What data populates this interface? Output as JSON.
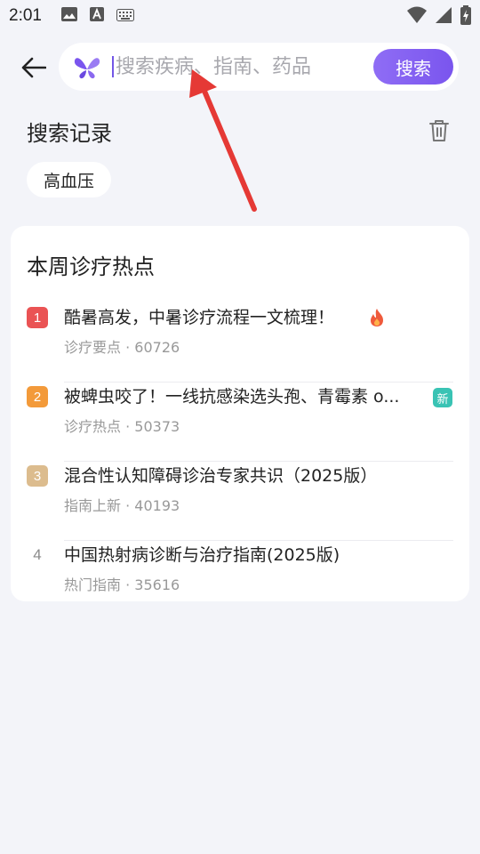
{
  "status_bar": {
    "time": "2:01"
  },
  "search": {
    "placeholder": "搜索疾病、指南、药品",
    "value": "",
    "button_label": "搜索"
  },
  "history": {
    "title": "搜索记录",
    "items": [
      "高血压"
    ]
  },
  "hot": {
    "title": "本周诊疗热点",
    "items": [
      {
        "rank": "1",
        "title": "酷暑高发，中暑诊疗流程一文梳理！",
        "category": "诊疗要点",
        "count": "60726",
        "badge": "fire-icon"
      },
      {
        "rank": "2",
        "title": "被蜱虫咬了！一线抗感染选头孢、青霉素 o...",
        "category": "诊疗热点",
        "count": "50373",
        "badge": "新"
      },
      {
        "rank": "3",
        "title": "混合性认知障碍诊治专家共识（2025版）",
        "category": "指南上新",
        "count": "40193",
        "badge": ""
      },
      {
        "rank": "4",
        "title": "中国热射病诊断与治疗指南(2025版)",
        "category": "热门指南",
        "count": "35616",
        "badge": ""
      }
    ],
    "meta_separator": " · "
  },
  "colors": {
    "accent": "#7a55ee",
    "background": "#f3f4f9",
    "annotation_arrow": "#e53935"
  }
}
